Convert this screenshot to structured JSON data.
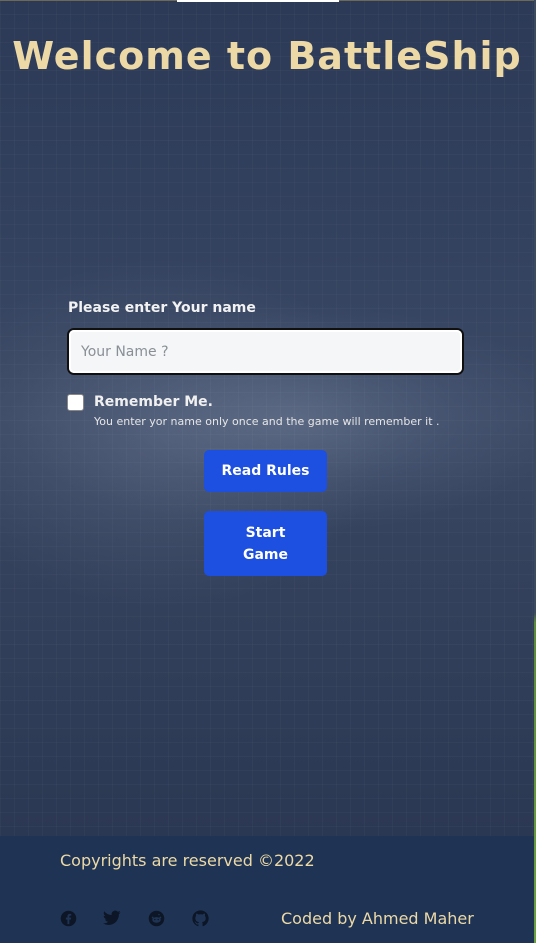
{
  "header": {
    "title": "Welcome to BattleShip"
  },
  "form": {
    "name_label": "Please enter Your name",
    "name_placeholder": "Your Name ?",
    "name_value": "",
    "remember_label": "Remember Me.",
    "remember_checked": false,
    "remember_help": "You enter yor name only once and the game will remember it ."
  },
  "buttons": {
    "read_rules": "Read Rules",
    "start_game": "Start Game"
  },
  "footer": {
    "copyright": "Copyrights are reserved ©2022",
    "credit": "Coded by Ahmed Maher",
    "social_icons": [
      "facebook-icon",
      "twitter-icon",
      "reddit-icon",
      "github-icon"
    ]
  },
  "colors": {
    "title": "#ecd9a6",
    "button": "#1d4fe0",
    "footer_bg": "#1f3455",
    "footer_text": "#ecd9a6"
  }
}
